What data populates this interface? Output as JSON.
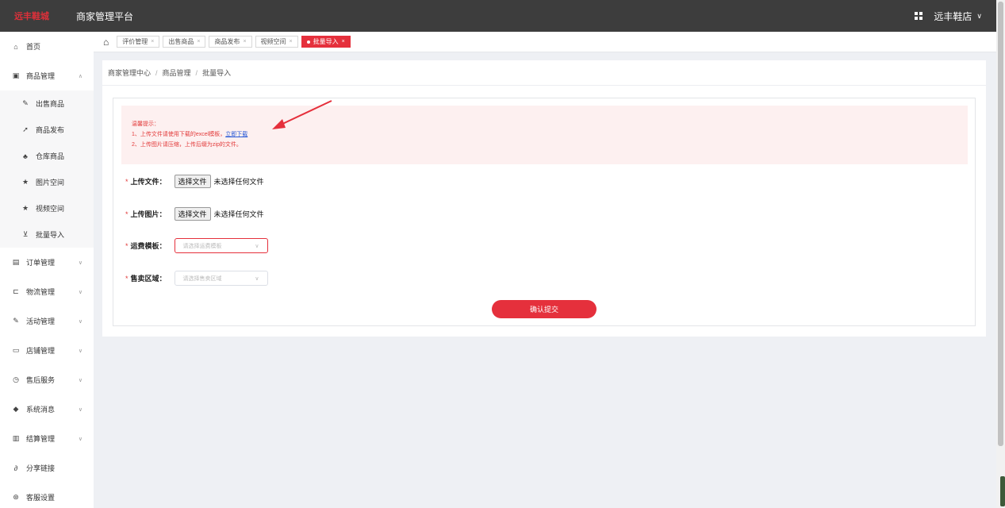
{
  "header": {
    "logo_text": "远丰鞋城",
    "app_title": "商家管理平台",
    "user_name": "远丰鞋店",
    "chevron": "∨"
  },
  "sidebar": {
    "items": [
      {
        "icon": "⌂",
        "label": "首页"
      },
      {
        "icon": "▣",
        "label": "商品管理",
        "arrow": "∧"
      },
      {
        "icon": "✎",
        "label": "出售商品",
        "sub": true
      },
      {
        "icon": "➚",
        "label": "商品发布",
        "sub": true
      },
      {
        "icon": "♣",
        "label": "仓库商品",
        "sub": true
      },
      {
        "icon": "★",
        "label": "图片空间",
        "sub": true
      },
      {
        "icon": "★",
        "label": "视频空间",
        "sub": true
      },
      {
        "icon": "⊻",
        "label": "批量导入",
        "sub": true
      },
      {
        "icon": "▤",
        "label": "订单管理",
        "arrow": "∨"
      },
      {
        "icon": "⊏",
        "label": "物流管理",
        "arrow": "∨"
      },
      {
        "icon": "✎",
        "label": "活动管理",
        "arrow": "∨"
      },
      {
        "icon": "▭",
        "label": "店铺管理",
        "arrow": "∨"
      },
      {
        "icon": "◷",
        "label": "售后服务",
        "arrow": "∨"
      },
      {
        "icon": "◆",
        "label": "系统消息",
        "arrow": "∨"
      },
      {
        "icon": "▥",
        "label": "结算管理",
        "arrow": "∨"
      },
      {
        "icon": "∂",
        "label": "分享链接"
      },
      {
        "icon": "⊛",
        "label": "客服设置"
      }
    ]
  },
  "tabs": {
    "home_icon": "⌂",
    "items": [
      {
        "label": "评价管理",
        "close": "×"
      },
      {
        "label": "出售商品",
        "close": "×"
      },
      {
        "label": "商品发布",
        "close": "×"
      },
      {
        "label": "视频空间",
        "close": "×"
      },
      {
        "label": "批量导入",
        "close": "×",
        "active": true
      }
    ]
  },
  "breadcrumb": {
    "items": [
      "商家管理中心",
      "商品管理",
      "批量导入"
    ],
    "separator": "/"
  },
  "tips": {
    "title": "温馨提示：",
    "line1_prefix": "1、上传文件请使用下载的excel模板，",
    "line1_link": "立即下载",
    "line2": "2、上传图片请压缩，上传后缀为zip的文件。"
  },
  "form": {
    "required_mark": "*",
    "upload_file": {
      "label": "上传文件：",
      "button": "选择文件",
      "status": "未选择任何文件"
    },
    "upload_image": {
      "label": "上传图片：",
      "button": "选择文件",
      "status": "未选择任何文件"
    },
    "shipping_template": {
      "label": "运费模板：",
      "placeholder": "请选择运费模板"
    },
    "sale_region": {
      "label": "售卖区域：",
      "placeholder": "请选择售卖区域"
    },
    "submit_label": "确认提交"
  },
  "colors": {
    "accent": "#e5303c",
    "topbar": "#3d3d3d",
    "tips_bg": "#fdf0f0"
  }
}
